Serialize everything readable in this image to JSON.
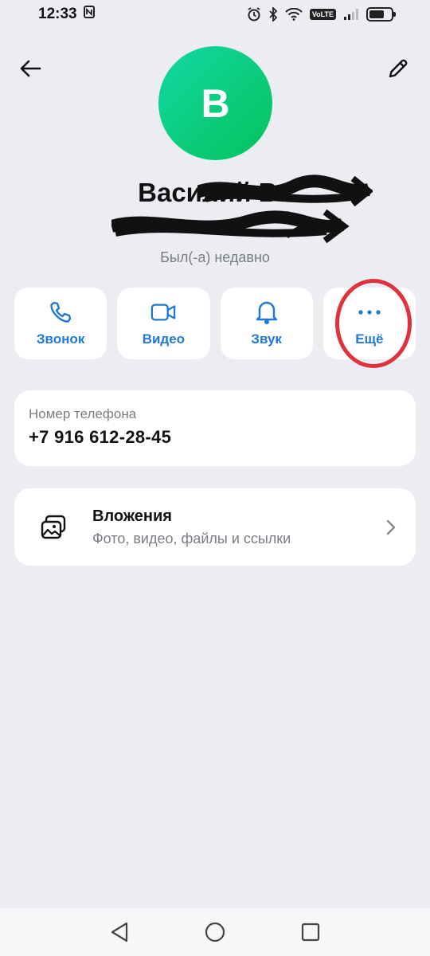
{
  "status_bar": {
    "time": "12:33",
    "volte": "VoLTE"
  },
  "contact": {
    "avatar_letter": "В",
    "name_visible": "Василий Ва",
    "presence": "Был(-а) недавно"
  },
  "actions": [
    {
      "label": "Звонок",
      "icon": "phone-icon"
    },
    {
      "label": "Видео",
      "icon": "video-icon"
    },
    {
      "label": "Звук",
      "icon": "bell-icon"
    },
    {
      "label": "Ещё",
      "icon": "more-dots-icon"
    }
  ],
  "phone": {
    "label": "Номер телефона",
    "value": "+7 916 612-28-45"
  },
  "attachments": {
    "title": "Вложения",
    "subtitle": "Фото, видео, файлы и ссылки"
  },
  "colors": {
    "background": "#ecedf2",
    "accent": "#1e78d4",
    "avatar_start": "#12d8a4",
    "avatar_end": "#05c25c",
    "highlight": "#e0323c"
  }
}
